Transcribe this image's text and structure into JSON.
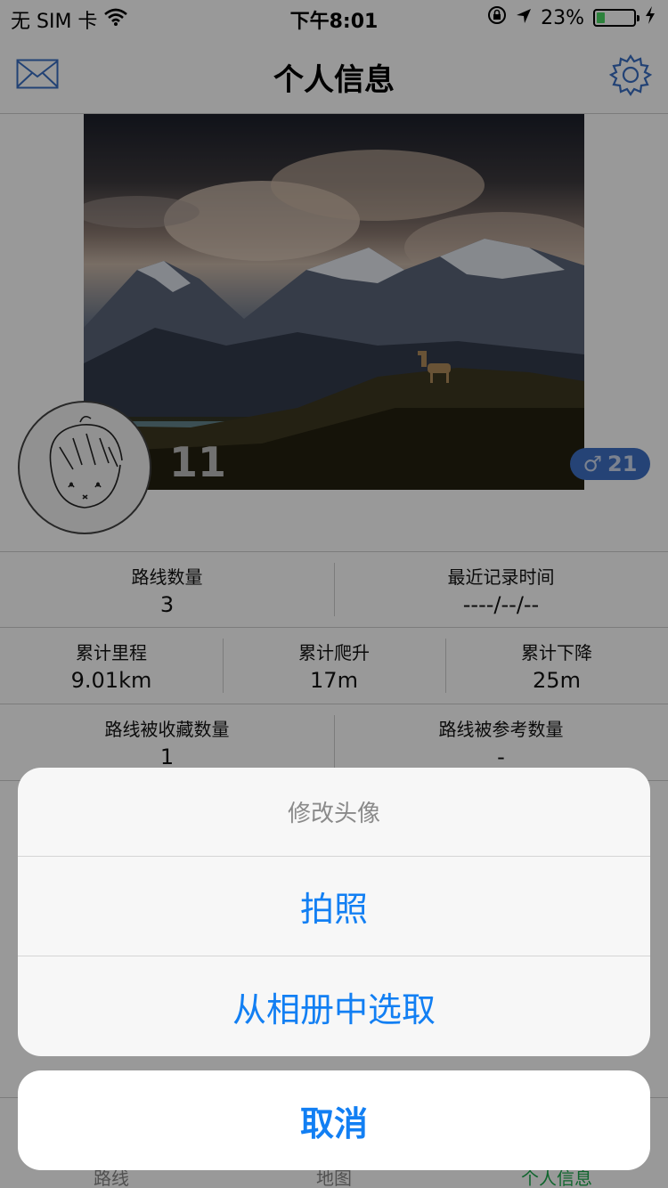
{
  "status_bar": {
    "carrier": "无 SIM 卡",
    "time": "下午8:01",
    "battery_percent": "23%",
    "battery_level": 0.23,
    "icons": [
      "wifi-icon",
      "rotation-lock-icon",
      "location-arrow-icon",
      "battery-icon",
      "charging-bolt-icon"
    ]
  },
  "navbar": {
    "title": "个人信息",
    "left_icon": "mail-icon",
    "right_icon": "gear-icon"
  },
  "profile": {
    "level": "11",
    "gender_symbol": "♂",
    "age": "21",
    "accent_color": "#3f71c5"
  },
  "stats": {
    "row1": [
      {
        "label": "路线数量",
        "value": "3"
      },
      {
        "label": "最近记录时间",
        "value": "----/--/--"
      }
    ],
    "row2": [
      {
        "label": "累计里程",
        "value": "9.01km"
      },
      {
        "label": "累计爬升",
        "value": "17m"
      },
      {
        "label": "累计下降",
        "value": "25m"
      }
    ],
    "row3": [
      {
        "label": "路线被收藏数量",
        "value": "1"
      },
      {
        "label": "路线被参考数量",
        "value": "-"
      }
    ]
  },
  "tabbar": {
    "tabs": [
      {
        "label": "路线"
      },
      {
        "label": "地图"
      },
      {
        "label": "个人信息"
      }
    ],
    "active_color": "#1aa84c"
  },
  "action_sheet": {
    "title": "修改头像",
    "actions": [
      {
        "label": "拍照"
      },
      {
        "label": "从相册中选取"
      }
    ],
    "cancel_label": "取消",
    "action_color": "#127ff3"
  }
}
